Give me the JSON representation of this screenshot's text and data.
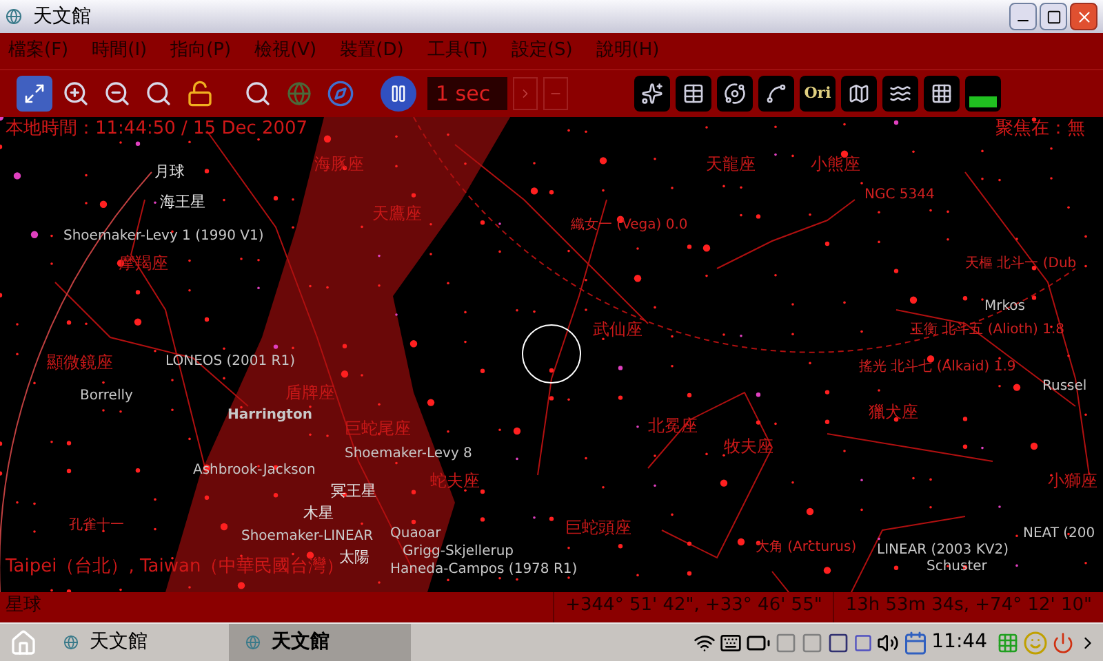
{
  "window": {
    "title": "天文館"
  },
  "menu": [
    "檔案(F)",
    "時間(I)",
    "指向(P)",
    "檢視(V)",
    "裝置(D)",
    "工具(T)",
    "設定(S)",
    "說明(H)"
  ],
  "toolbar": {
    "time_step": "1 sec",
    "names_toggle": "Ori"
  },
  "sky_labels": [
    {
      "text": "本地時間：11:44:50 / 15 Dec 2007",
      "kind": "info"
    },
    {
      "text": "聚焦在：無",
      "kind": "info"
    },
    {
      "text": "月球",
      "kind": "planet"
    },
    {
      "text": "海王星",
      "kind": "planet"
    },
    {
      "text": "海豚座",
      "kind": "constellation"
    },
    {
      "text": "天鷹座",
      "kind": "constellation"
    },
    {
      "text": "天龍座",
      "kind": "constellation"
    },
    {
      "text": "小熊座",
      "kind": "constellation"
    },
    {
      "text": "NGC 5344",
      "kind": "star"
    },
    {
      "text": "織女一 (Vega) 0.0",
      "kind": "star"
    },
    {
      "text": "Shoemaker-Levy 1 (1990 V1)",
      "kind": "comet"
    },
    {
      "text": "摩羯座",
      "kind": "constellation"
    },
    {
      "text": "天樞 北斗一 (Dub",
      "kind": "star"
    },
    {
      "text": "Mrkos",
      "kind": "comet"
    },
    {
      "text": "武仙座",
      "kind": "constellation"
    },
    {
      "text": "玉衡 北斗五 (Alioth) 1.8",
      "kind": "star"
    },
    {
      "text": "顯微鏡座",
      "kind": "constellation"
    },
    {
      "text": "LONEOS (2001 R1)",
      "kind": "comet"
    },
    {
      "text": "搖光 北斗七 (Alkaid) 1.9",
      "kind": "star"
    },
    {
      "text": "Russel",
      "kind": "comet"
    },
    {
      "text": "Borrelly",
      "kind": "comet"
    },
    {
      "text": "獵犬座",
      "kind": "constellation"
    },
    {
      "text": "盾牌座",
      "kind": "constellation"
    },
    {
      "text": "Harrington",
      "kind": "comet",
      "bold": true
    },
    {
      "text": "北冕座",
      "kind": "constellation"
    },
    {
      "text": "巨蛇尾座",
      "kind": "constellation"
    },
    {
      "text": "牧夫座",
      "kind": "constellation"
    },
    {
      "text": "Ashbrook-Jackson",
      "kind": "comet"
    },
    {
      "text": "Shoemaker-Levy 8",
      "kind": "comet"
    },
    {
      "text": "蛇夫座",
      "kind": "constellation"
    },
    {
      "text": "小獅座",
      "kind": "constellation"
    },
    {
      "text": "冥王星",
      "kind": "planet"
    },
    {
      "text": "木星",
      "kind": "planet"
    },
    {
      "text": "孔雀十一",
      "kind": "star"
    },
    {
      "text": "巨蛇頭座",
      "kind": "constellation"
    },
    {
      "text": "Shoemaker-LINEAR",
      "kind": "comet"
    },
    {
      "text": "Quaoar",
      "kind": "comet"
    },
    {
      "text": "大角 (Arcturus)",
      "kind": "star"
    },
    {
      "text": "LINEAR (2003 KV2)",
      "kind": "comet"
    },
    {
      "text": "NEAT (200",
      "kind": "comet"
    },
    {
      "text": "太陽",
      "kind": "planet"
    },
    {
      "text": "Grigg-Skjellerup",
      "kind": "comet"
    },
    {
      "text": "Taipei（台北）, Taiwan（中華民國台灣）",
      "kind": "info"
    },
    {
      "text": "Haneda-Campos (1978 R1)",
      "kind": "comet"
    },
    {
      "text": "Schuster",
      "kind": "comet"
    }
  ],
  "status_bar": [
    "星球",
    "+344° 51' 42\", +33° 46' 55\"",
    "13h 53m 34s, +74° 12' 10\""
  ],
  "taskbar": {
    "tasks": [
      {
        "label": "天文館",
        "selected": false
      },
      {
        "label": "天文館",
        "selected": true
      }
    ],
    "clock": "11:44"
  }
}
